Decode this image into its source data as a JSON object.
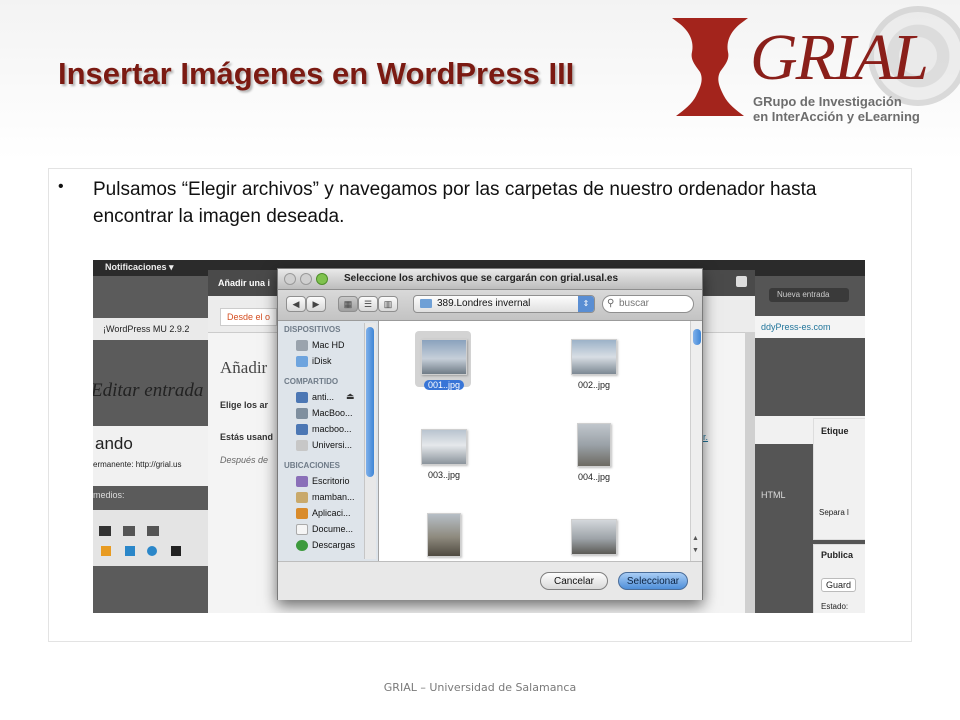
{
  "slide": {
    "title": "Insertar Imágenes en WordPress III",
    "bullet": "Pulsamos “Elegir archivos” y navegamos por las carpetas de nuestro ordenador hasta encontrar la imagen deseada.",
    "footer": "GRIAL – Universidad de Salamanca"
  },
  "logo": {
    "wordmark": "GRIAL",
    "line1": "GRupo de Investigación",
    "line2": "en InterAcción y eLearning",
    "color": "#8a1f1a"
  },
  "wordpress": {
    "notifications": "Notificaciones ▾",
    "dialog_title": "Añadir una i",
    "wp_version": "¡WordPress MU 2.9.2",
    "tab": "Desde el o",
    "heading": "Añadir",
    "choose_text": "Elige los ar",
    "using_text": "Estás usand",
    "after_text": "Después de",
    "link_text": "ador.",
    "editing": "Editar entrada",
    "post_fragment": "ando",
    "permalink": "ermanente: http://grial.us",
    "media": "medios:",
    "new_entry": "Nueva entrada",
    "buddy": "ddyPress-es.com",
    "tags": "Etique",
    "separate": "Separa l",
    "html_tab": "HTML",
    "publish": "Publica",
    "save": "Guard",
    "status": "Estado:"
  },
  "file_dialog": {
    "title": "Seleccione los archivos que se cargarán con grial.usal.es",
    "current_folder": "389.Londres invernal",
    "search_placeholder": "buscar",
    "sidebar": [
      {
        "section": "DISPOSITIVOS",
        "items": [
          {
            "label": "Mac HD",
            "icon": "hard-drive-icon"
          },
          {
            "label": "iDisk",
            "icon": "idisk-icon"
          }
        ]
      },
      {
        "section": "COMPARTIDO",
        "items": [
          {
            "label": "anti...",
            "icon": "network-computer-icon"
          },
          {
            "label": "MacBoo...",
            "icon": "laptop-icon"
          },
          {
            "label": "macboo...",
            "icon": "network-computer-icon"
          },
          {
            "label": "Universi...",
            "icon": "server-icon"
          }
        ]
      },
      {
        "section": "UBICACIONES",
        "items": [
          {
            "label": "Escritorio",
            "icon": "desktop-icon"
          },
          {
            "label": "mamban...",
            "icon": "home-icon"
          },
          {
            "label": "Aplicaci...",
            "icon": "applications-icon"
          },
          {
            "label": "Docume...",
            "icon": "documents-icon"
          },
          {
            "label": "Descargas",
            "icon": "downloads-icon"
          }
        ]
      }
    ],
    "files": [
      {
        "name": "001..jpg",
        "selected": true
      },
      {
        "name": "002..jpg",
        "selected": false
      },
      {
        "name": "003..jpg",
        "selected": false
      },
      {
        "name": "004..jpg",
        "selected": false
      },
      {
        "name": "",
        "selected": false
      },
      {
        "name": "",
        "selected": false
      }
    ],
    "cancel_label": "Cancelar",
    "ok_label": "Seleccionar"
  }
}
